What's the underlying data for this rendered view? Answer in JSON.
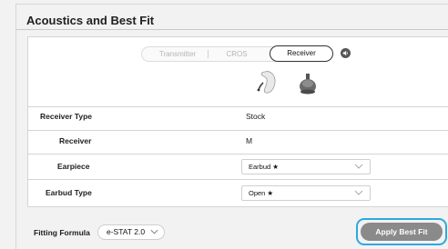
{
  "section": {
    "title": "Acoustics and Best Fit"
  },
  "mode_selector": {
    "options": [
      "Transmitter",
      "CROS",
      "Receiver"
    ],
    "selected": "Receiver"
  },
  "icons": {
    "speaker": "speaker-icon",
    "devices": [
      "hearing-aid-device-icon",
      "earbud-dome-icon"
    ]
  },
  "rows": [
    {
      "label": "Receiver Type",
      "value": "Stock"
    },
    {
      "label": "Receiver",
      "value": "M"
    },
    {
      "label": "Earpiece",
      "value": "Earbud ★"
    },
    {
      "label": "Earbud Type",
      "value": "Open ★"
    }
  ],
  "fitting_formula": {
    "label": "Fitting Formula",
    "value": "e-STAT 2.0"
  },
  "actions": {
    "apply_best_fit": "Apply Best Fit"
  },
  "colors": {
    "highlight": "#2ea8e0",
    "button": "#8a8a8a"
  }
}
